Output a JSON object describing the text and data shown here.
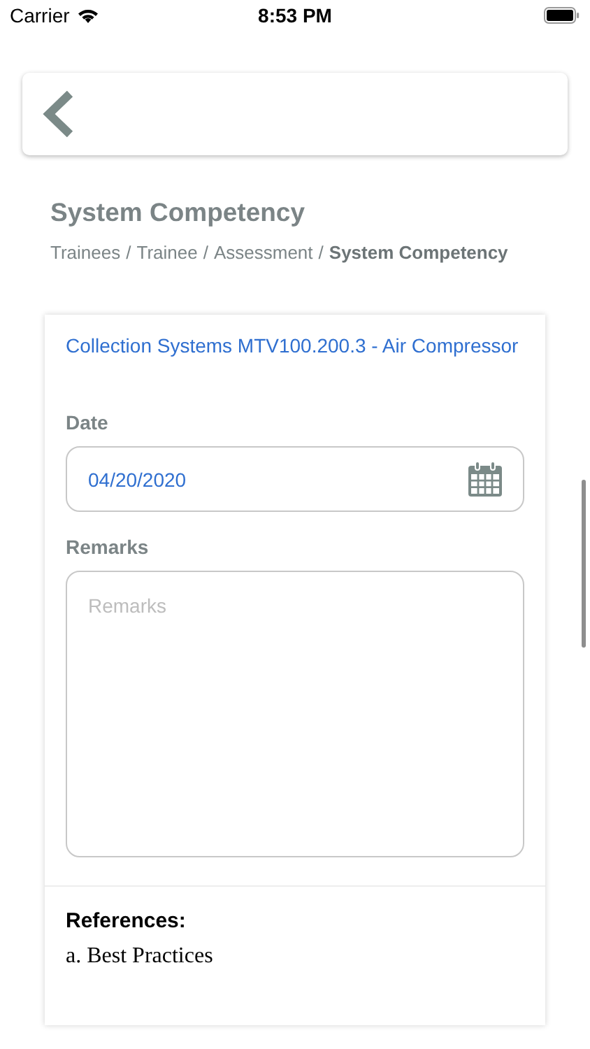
{
  "status_bar": {
    "carrier": "Carrier",
    "time": "8:53 PM"
  },
  "header": {
    "title": "System Competency",
    "breadcrumb": [
      {
        "label": "Trainees",
        "current": false
      },
      {
        "label": "Trainee",
        "current": false
      },
      {
        "label": "Assessment",
        "current": false
      },
      {
        "label": "System Competency",
        "current": true
      }
    ],
    "separator": "/"
  },
  "card": {
    "title": "Collection Systems MTV100.200.3 - Air Compressor",
    "date": {
      "label": "Date",
      "value": "04/20/2020"
    },
    "remarks": {
      "label": "Remarks",
      "placeholder": "Remarks"
    },
    "references": {
      "heading": "References:",
      "items": [
        "a. Best Practices"
      ]
    }
  }
}
